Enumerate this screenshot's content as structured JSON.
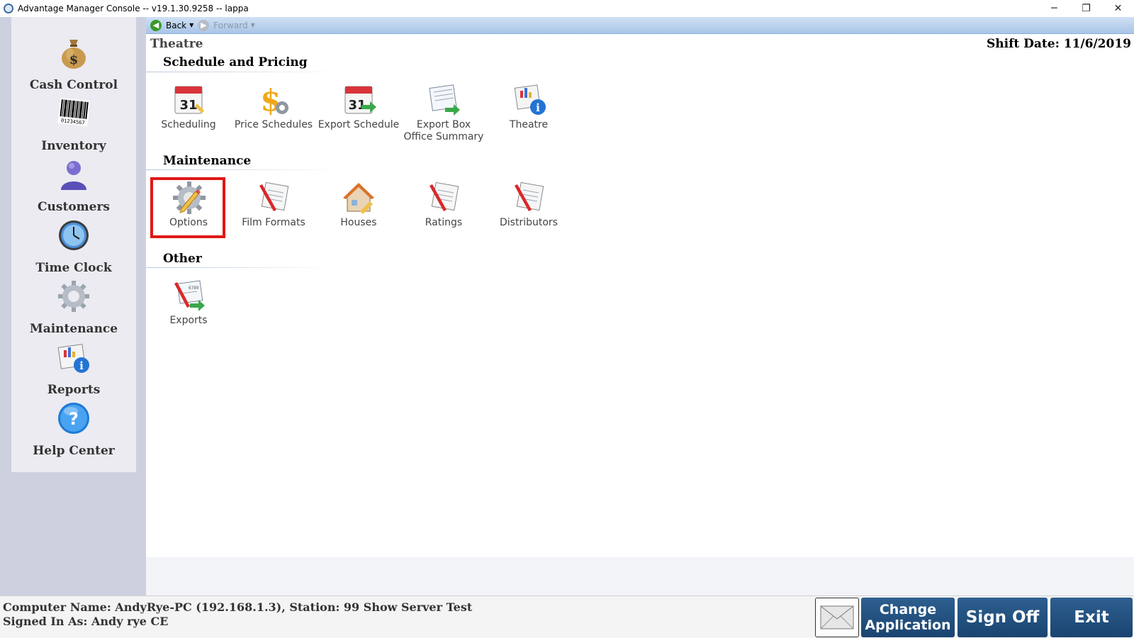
{
  "window": {
    "title": "Advantage Manager Console -- v19.1.30.9258 -- lappa",
    "controls": {
      "minimize": "─",
      "restore": "❐",
      "close": "✕"
    }
  },
  "sidebar": {
    "items": [
      {
        "label": "Cash Control",
        "icon": "money-bag-icon"
      },
      {
        "label": "Inventory",
        "icon": "barcode-icon"
      },
      {
        "label": "Customers",
        "icon": "user-icon"
      },
      {
        "label": "Time Clock",
        "icon": "clock-icon"
      },
      {
        "label": "Maintenance",
        "icon": "gear-icon"
      },
      {
        "label": "Reports",
        "icon": "report-info-icon"
      },
      {
        "label": "Help Center",
        "icon": "help-icon"
      }
    ]
  },
  "nav": {
    "back": "Back",
    "forward": "Forward"
  },
  "header": {
    "title": "Theatre",
    "shift_date": "Shift Date: 11/6/2019"
  },
  "sections": {
    "schedule_pricing": {
      "title": "Schedule and Pricing",
      "tiles": [
        {
          "label": "Scheduling",
          "icon": "calendar-icon"
        },
        {
          "label": "Price Schedules",
          "icon": "dollar-gear-icon"
        },
        {
          "label": "Export Schedule",
          "icon": "calendar-export-icon"
        },
        {
          "label": "Export Box Office Summary",
          "icon": "sheet-export-icon"
        },
        {
          "label": "Theatre",
          "icon": "report-info-icon"
        }
      ]
    },
    "maintenance": {
      "title": "Maintenance",
      "tiles": [
        {
          "label": "Options",
          "icon": "gear-pencil-icon",
          "highlighted": true
        },
        {
          "label": "Film Formats",
          "icon": "pencil-list-icon"
        },
        {
          "label": "Houses",
          "icon": "house-icon"
        },
        {
          "label": "Ratings",
          "icon": "pencil-list-icon"
        },
        {
          "label": "Distributors",
          "icon": "pencil-list-icon"
        }
      ]
    },
    "other": {
      "title": "Other",
      "tiles": [
        {
          "label": "Exports",
          "icon": "export-icon"
        }
      ]
    }
  },
  "status": {
    "computer": "Computer Name: AndyRye-PC (192.168.1.3), Station: 99 Show Server Test",
    "signed_in": "Signed In As: Andy rye CE"
  },
  "buttons": {
    "change_application": "Change Application",
    "sign_off": "Sign Off",
    "exit": "Exit"
  },
  "colors": {
    "sidebar_bg": "#cdd1df",
    "sidebar_panel": "#ebebf1",
    "button_blue": "#1f4f7f",
    "highlight_red": "#e01818",
    "nav_blue": "#b8d0ee"
  }
}
